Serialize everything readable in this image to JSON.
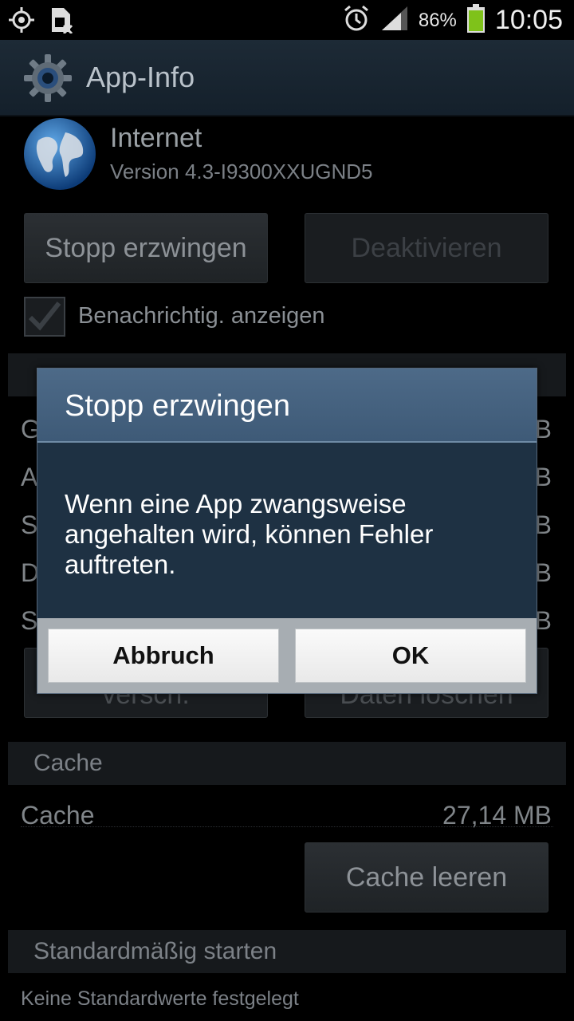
{
  "statusbar": {
    "battery_percent": "86%",
    "time": "10:05",
    "icons": [
      "location-icon",
      "sim-icon",
      "alarm-icon",
      "signal-icon",
      "battery-icon"
    ]
  },
  "actionbar": {
    "title": "App-Info"
  },
  "app": {
    "name": "Internet",
    "version": "Version 4.3-I9300XXUGND5"
  },
  "buttons": {
    "force_stop": "Stopp erzwingen",
    "disable": "Deaktivieren",
    "move": "versch.",
    "clear_data": "Daten löschen",
    "clear_cache": "Cache leeren"
  },
  "notification_checkbox": {
    "label": "Benachrichtig. anzeigen",
    "checked": true
  },
  "storage_rows": [
    {
      "label": "G",
      "value": "B"
    },
    {
      "label": "A",
      "value": "B"
    },
    {
      "label": "S",
      "value": "B"
    },
    {
      "label": "D",
      "value": "B"
    },
    {
      "label": "S",
      "value": "B"
    }
  ],
  "cache_section": {
    "title": "Cache",
    "row_label": "Cache",
    "row_value": "27,14 MB"
  },
  "default_section": {
    "title": "Standardmäßig starten",
    "text": "Keine Standardwerte festgelegt"
  },
  "dialog": {
    "title": "Stopp erzwingen",
    "message": "Wenn eine App zwangsweise angehalten wird, können Fehler auftreten.",
    "cancel_label": "Abbruch",
    "ok_label": "OK"
  },
  "colors": {
    "dialog_header": "#4d6a88",
    "dialog_body": "#1e3143",
    "actionbar": "#1d2a36"
  }
}
